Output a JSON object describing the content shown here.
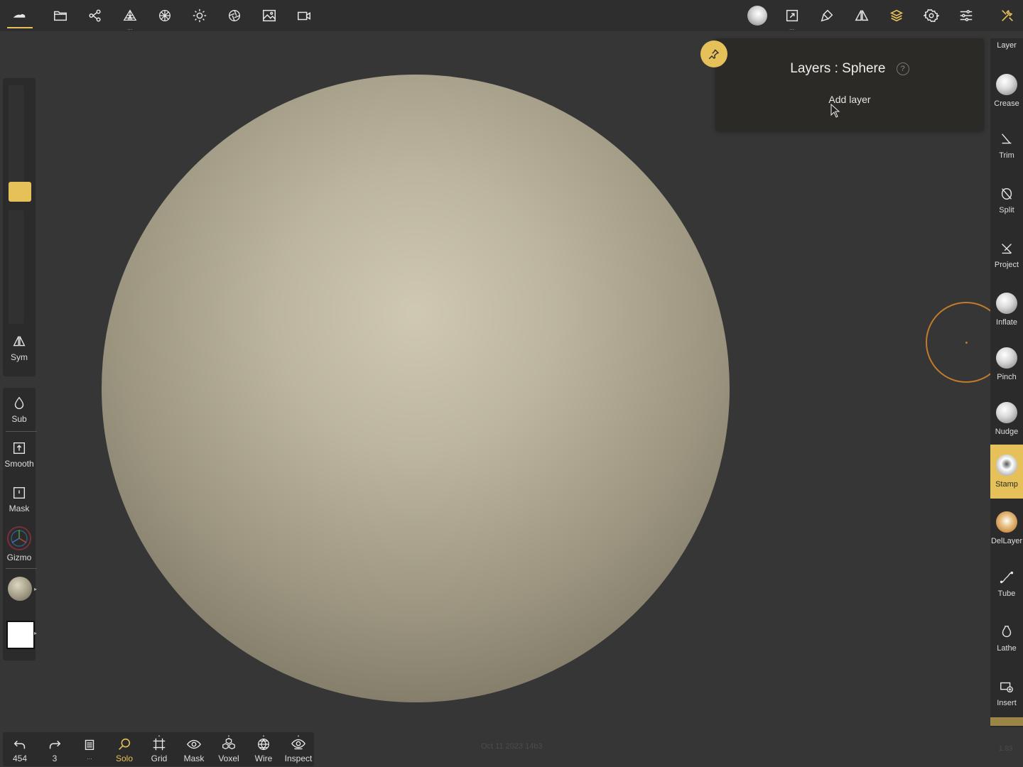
{
  "colors": {
    "accent": "#e6c15a",
    "background": "#363636",
    "panel": "#2b2b2b",
    "brush_ring": "#c47a2c",
    "sphere": "#bcb59f"
  },
  "topbar": {
    "left_icons": [
      "nomad-logo-icon",
      "folder-icon",
      "scene-graph-icon",
      "topology-icon",
      "material-sphere-icon",
      "light-icon",
      "render-shading-icon",
      "background-image-icon",
      "camera-icon"
    ],
    "right_icons": [
      "stamp-alpha-icon",
      "transform-icon",
      "paint-brush-icon",
      "symmetry-icon",
      "layers-icon",
      "settings-icon",
      "tool-options-icon",
      "tools-icon"
    ]
  },
  "left_panel": {
    "sym_label": "Sym",
    "sub_label": "Sub",
    "smooth_label": "Smooth",
    "mask_label": "Mask",
    "gizmo_label": "Gizmo"
  },
  "layers_panel": {
    "title": "Layers : Sphere",
    "help": "?",
    "add_layer": "Add layer"
  },
  "right_tools": {
    "header": "Layer",
    "items": [
      {
        "label": "Crease"
      },
      {
        "label": "Trim"
      },
      {
        "label": "Split"
      },
      {
        "label": "Project"
      },
      {
        "label": "Inflate"
      },
      {
        "label": "Pinch"
      },
      {
        "label": "Nudge"
      },
      {
        "label": "Stamp",
        "active": true
      },
      {
        "label": "DelLayer"
      },
      {
        "label": "Tube"
      },
      {
        "label": "Lathe"
      },
      {
        "label": "Insert"
      }
    ]
  },
  "bottom_bar": {
    "undo_count": "454",
    "redo_count": "3",
    "more": "...",
    "solo": "Solo",
    "grid": "Grid",
    "mask": "Mask",
    "voxel": "Voxel",
    "wire": "Wire",
    "inspect": "Inspect"
  },
  "footer": {
    "timestamp": "Oct 11 2023 14b3",
    "version": "1.83"
  }
}
